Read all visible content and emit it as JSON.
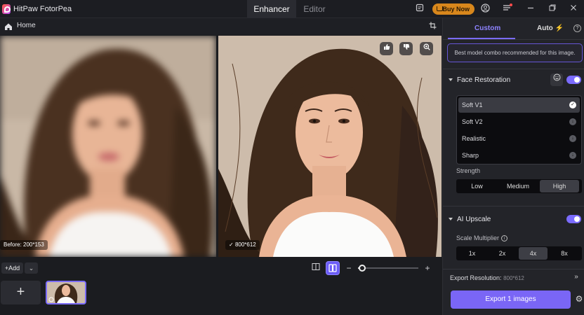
{
  "app": {
    "title": "HitPaw FotorPea"
  },
  "tabs": [
    {
      "label": "Enhancer",
      "active": true
    },
    {
      "label": "Editor",
      "active": false
    }
  ],
  "titlebar": {
    "buy_now": "Buy Now",
    "icons": [
      "feedback-icon",
      "cart-icon",
      "account-icon",
      "menu-icon",
      "minimize-icon",
      "maximize-icon",
      "close-icon"
    ]
  },
  "home": {
    "label": "Home"
  },
  "preview": {
    "before_label": "Before: 200*153",
    "after_label": "800*612",
    "icons": [
      "thumbs-up-icon",
      "thumbs-down-icon",
      "zoom-icon"
    ]
  },
  "bottom": {
    "add_label": "Add",
    "add_tile": "+"
  },
  "sidebar": {
    "tabs": [
      {
        "label": "Custom",
        "active": true
      },
      {
        "label": "Auto",
        "active": false
      }
    ],
    "info": "Best model combo recommended for this image.",
    "face_restoration": {
      "title": "Face Restoration",
      "enabled": true,
      "models": [
        {
          "label": "Soft V1",
          "selected": true
        },
        {
          "label": "Soft V2",
          "selected": false
        },
        {
          "label": "Realistic",
          "selected": false
        },
        {
          "label": "Sharp",
          "selected": false
        }
      ],
      "strength_label": "Strength",
      "strength_options": [
        "Low",
        "Medium",
        "High"
      ],
      "strength_selected": "High"
    },
    "ai_upscale": {
      "title": "AI Upscale",
      "enabled": true,
      "scale_label": "Scale Multiplier",
      "scale_options": [
        "1x",
        "2x",
        "4x",
        "8x"
      ],
      "scale_selected": "4x"
    },
    "export_resolution_label": "Export Resolution:",
    "export_resolution_value": "800*612",
    "export_button": "Export 1 images"
  },
  "colors": {
    "accent": "#7b6cff",
    "buy_now": "#d8871c",
    "background": "#1b1c20"
  }
}
